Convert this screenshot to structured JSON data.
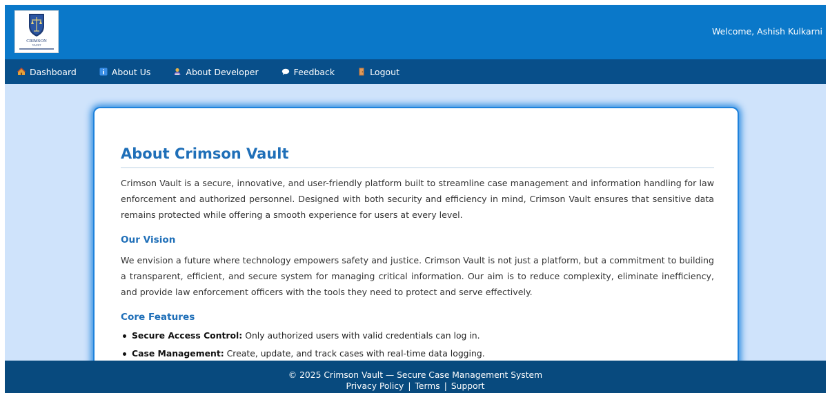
{
  "header": {
    "welcome_text": "Welcome, Ashish Kulkarni"
  },
  "nav": {
    "items": [
      {
        "label": "Dashboard",
        "icon": "house-icon"
      },
      {
        "label": "About Us",
        "icon": "info-icon"
      },
      {
        "label": "About Developer",
        "icon": "developer-icon"
      },
      {
        "label": "Feedback",
        "icon": "speech-bubble-icon"
      },
      {
        "label": "Logout",
        "icon": "door-icon"
      }
    ]
  },
  "content": {
    "title": "About Crimson Vault",
    "intro": "Crimson Vault is a secure, innovative, and user-friendly platform built to streamline case management and information handling for law enforcement and authorized personnel. Designed with both security and efficiency in mind, Crimson Vault ensures that sensitive data remains protected while offering a smooth experience for users at every level.",
    "vision_title": "Our Vision",
    "vision_text": "We envision a future where technology empowers safety and justice. Crimson Vault is not just a platform, but a commitment to building a transparent, efficient, and secure system for managing critical information. Our aim is to reduce complexity, eliminate inefficiency, and provide law enforcement officers with the tools they need to protect and serve effectively.",
    "features_title": "Core Features",
    "features": [
      {
        "name": "Secure Access Control:",
        "text": " Only authorized users with valid credentials can log in."
      },
      {
        "name": "Case Management:",
        "text": " Create, update, and track cases with real-time data logging."
      }
    ]
  },
  "footer": {
    "copyright": "© 2025 Crimson Vault — Secure Case Management System",
    "links": [
      "Privacy Policy",
      "Terms",
      "Support"
    ],
    "separator": "|"
  },
  "colors": {
    "header_bg": "#0a78c9",
    "nav_bg": "#084f8a",
    "page_bg": "#cfe3fb",
    "accent": "#1f6fb8",
    "footer_bg": "#084a7e"
  }
}
